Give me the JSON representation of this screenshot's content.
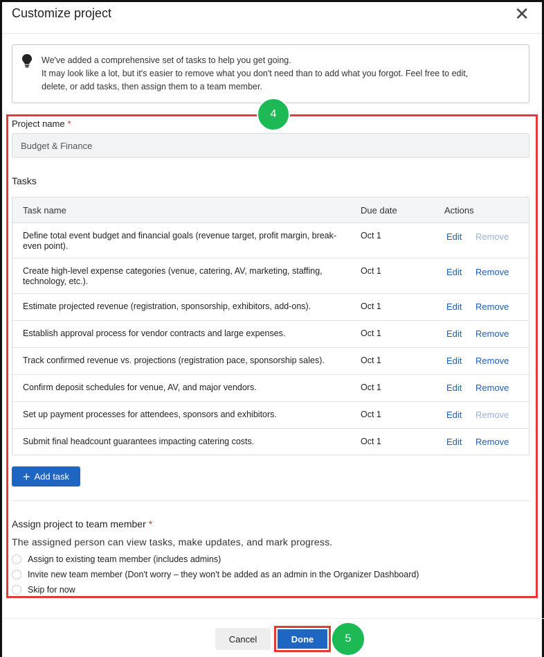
{
  "dialog": {
    "title": "Customize project",
    "close_label": "✕"
  },
  "tip": {
    "icon": "lightbulb-icon",
    "lines": [
      "We've added a comprehensive set of tasks to help you get going.",
      "It may look like a lot, but it's easier to remove what you don't need than to add what you forgot. Feel free to edit,",
      "delete, or add tasks, then assign them to a team member."
    ]
  },
  "annotations": {
    "step_4": "4",
    "step_5": "5",
    "highlight_color": "#e53935",
    "badge_color": "#1db954"
  },
  "project": {
    "name_label": "Project name",
    "required_mark": "*",
    "name_value": "Budget & Finance"
  },
  "tasks": {
    "section_label": "Tasks",
    "columns": [
      "Task name",
      "Due date",
      "Actions"
    ],
    "edit_label": "Edit",
    "remove_label": "Remove",
    "rows": [
      {
        "name": "Define total event budget and financial goals (revenue target, profit margin, break-even point).",
        "due": "Oct 1",
        "remove_enabled": false
      },
      {
        "name": "Create high-level expense categories (venue, catering, AV, marketing, staffing, technology, etc.).",
        "due": "Oct 1",
        "remove_enabled": true
      },
      {
        "name": "Estimate projected revenue (registration, sponsorship, exhibitors, add-ons).",
        "due": "Oct 1",
        "remove_enabled": true
      },
      {
        "name": "Establish approval process for vendor contracts and large expenses.",
        "due": "Oct 1",
        "remove_enabled": true
      },
      {
        "name": "Track confirmed revenue vs. projections (registration pace, sponsorship sales).",
        "due": "Oct 1",
        "remove_enabled": true
      },
      {
        "name": "Confirm deposit schedules for venue, AV, and major vendors.",
        "due": "Oct 1",
        "remove_enabled": true
      },
      {
        "name": "Set up payment processes for attendees, sponsors and exhibitors.",
        "due": "Oct 1",
        "remove_enabled": false
      },
      {
        "name": "Submit final headcount guarantees impacting catering costs.",
        "due": "Oct 1",
        "remove_enabled": true
      }
    ],
    "add_label": "Add task"
  },
  "assign": {
    "label": "Assign project to team member",
    "required_mark": "*",
    "description": "The assigned person can view tasks, make updates, and mark progress.",
    "options": [
      "Assign to existing team member (includes admins)",
      "Invite new team member (Don't worry – they won't be added as an admin in the Organizer Dashboard)",
      "Skip for now"
    ]
  },
  "footer": {
    "cancel_label": "Cancel",
    "done_label": "Done"
  },
  "colors": {
    "primary": "#1e66c2",
    "link": "#1e5eb4",
    "link_disabled": "#9bb3d4"
  }
}
